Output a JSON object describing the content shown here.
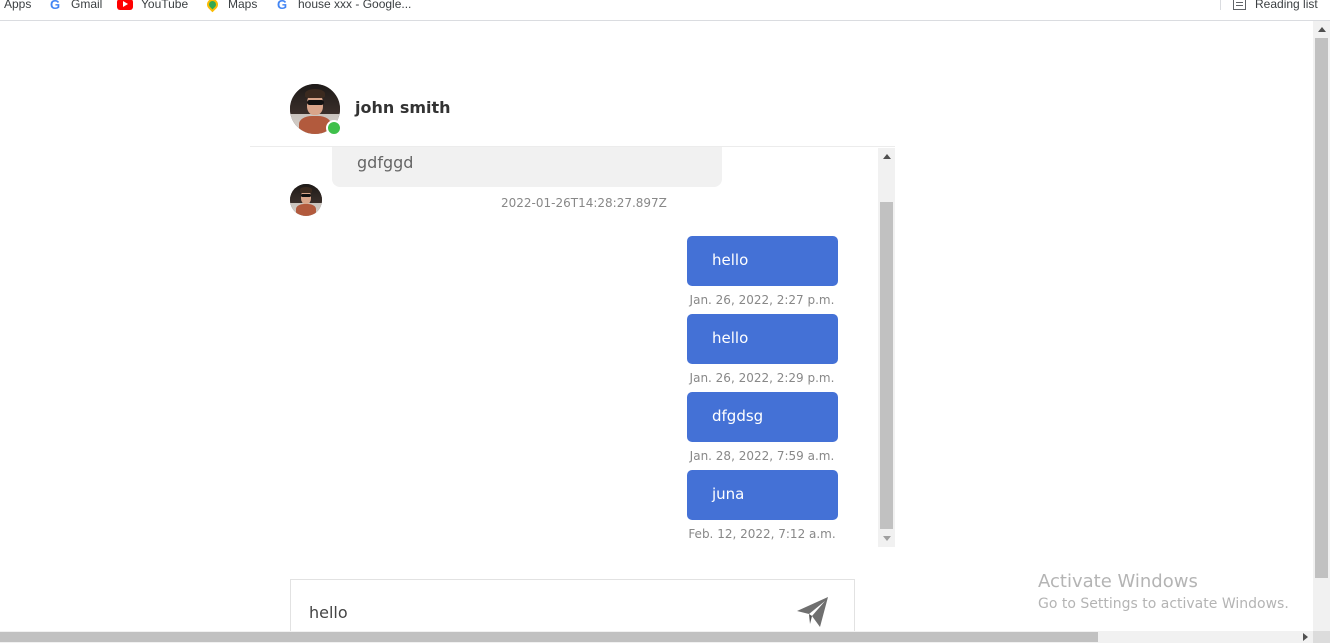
{
  "bookmarks": {
    "items": [
      {
        "label": "Apps",
        "icon": "apps-grid-icon"
      },
      {
        "label": "Gmail",
        "icon": "google-icon"
      },
      {
        "label": "YouTube",
        "icon": "youtube-icon"
      },
      {
        "label": "Maps",
        "icon": "maps-icon"
      },
      {
        "label": "house xxx - Google...",
        "icon": "google-icon"
      }
    ],
    "reading_list": "Reading list"
  },
  "contact": {
    "name": "john smith",
    "status": "online"
  },
  "messages": [
    {
      "direction": "in",
      "text": "gdfggd",
      "timestamp": "2022-01-26T14:28:27.897Z"
    },
    {
      "direction": "out",
      "text": "hello",
      "timestamp": "Jan. 26, 2022, 2:27 p.m."
    },
    {
      "direction": "out",
      "text": "hello",
      "timestamp": "Jan. 26, 2022, 2:29 p.m."
    },
    {
      "direction": "out",
      "text": "dfgdsg",
      "timestamp": "Jan. 28, 2022, 7:59 a.m."
    },
    {
      "direction": "out",
      "text": "juna",
      "timestamp": "Feb. 12, 2022, 7:12 a.m."
    }
  ],
  "composer": {
    "value": "hello"
  },
  "watermark": {
    "title": "Activate Windows",
    "subtitle": "Go to Settings to activate Windows."
  },
  "colors": {
    "outgoing_bubble": "#4471d6",
    "incoming_bubble": "#f1f1f1",
    "online": "#3fc04b"
  }
}
